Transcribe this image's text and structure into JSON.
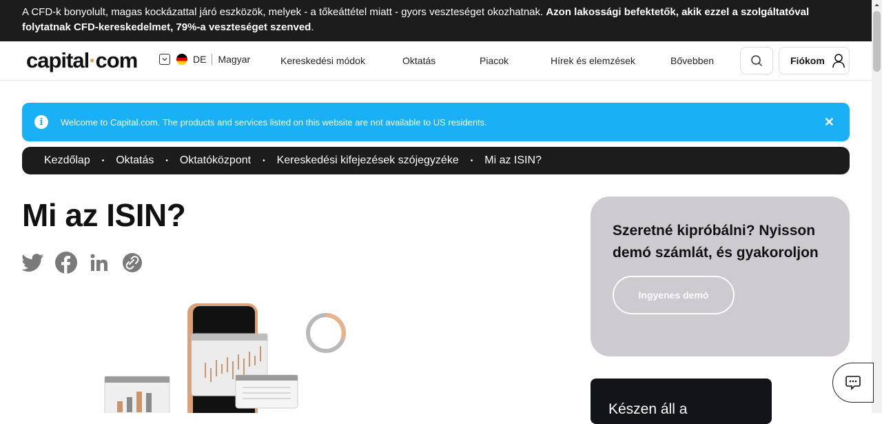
{
  "risk_warning": {
    "text": "A CFD-k bonyolult, magas kockázattal járó eszközök, melyek - a tőkeáttétel miatt - gyors veszteséget okozhatnak. ",
    "bold": "Azon lakossági befektetők, akik ezzel a szolgáltatóval folytatnak CFD-kereskedelmet, 79%-a veszteséget szenved",
    "end": "."
  },
  "header": {
    "logo_left": "capital",
    "logo_dot": "·",
    "logo_right": "com",
    "country": "DE",
    "language": "Magyar",
    "nav": [
      "Kereskedési módok",
      "Oktatás",
      "Piacok",
      "Hírek és elemzések",
      "Bővebben"
    ],
    "account_label": "Fiókom"
  },
  "notice": {
    "info_glyph": "i",
    "text": "Welcome to Capital.com. The products and services listed on this website are not available to US residents.",
    "close_glyph": "✕"
  },
  "breadcrumb": [
    "Kezdőlap",
    "Oktatás",
    "Oktatóközpont",
    "Kereskedési kifejezések szójegyzéke",
    "Mi az ISIN?"
  ],
  "breadcrumb_separator": "•",
  "page": {
    "title": "Mi az ISIN?"
  },
  "promo": {
    "heading": "Szeretné kipróbálni? Nyisson demó számlát, és gyakoroljon",
    "button": "Ingyenes demó"
  },
  "dark_card": {
    "text": "Készen áll a"
  },
  "icons": {
    "share": [
      "twitter-icon",
      "facebook-icon",
      "linkedin-icon",
      "link-icon"
    ],
    "search": "search-icon",
    "account": "user-icon",
    "chat": "chat-icon"
  },
  "colors": {
    "accent_blue": "#1ab0f6",
    "brand_gold": "#d69b5c",
    "dark": "#1c1c1c",
    "promo_bg": "#cdcad0"
  }
}
